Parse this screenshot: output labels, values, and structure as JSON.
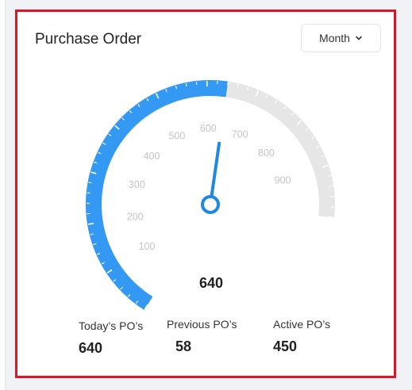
{
  "card": {
    "title": "Purchase Order",
    "period_select": {
      "value": "Month"
    }
  },
  "gauge": {
    "value": 640,
    "value_text": "640",
    "min": 0,
    "max": 1000,
    "tick_labels": [
      "100",
      "200",
      "300",
      "400",
      "500",
      "600",
      "700",
      "800",
      "900"
    ],
    "fill_color": "#3399f3",
    "track_color": "#e6e6e6",
    "needle_color": "#1e88e5"
  },
  "stats": [
    {
      "label": "Today’s PO’s",
      "value": "640"
    },
    {
      "label": "Previous PO’s",
      "value": "58"
    },
    {
      "label": "Active PO’s",
      "value": "450"
    }
  ]
}
